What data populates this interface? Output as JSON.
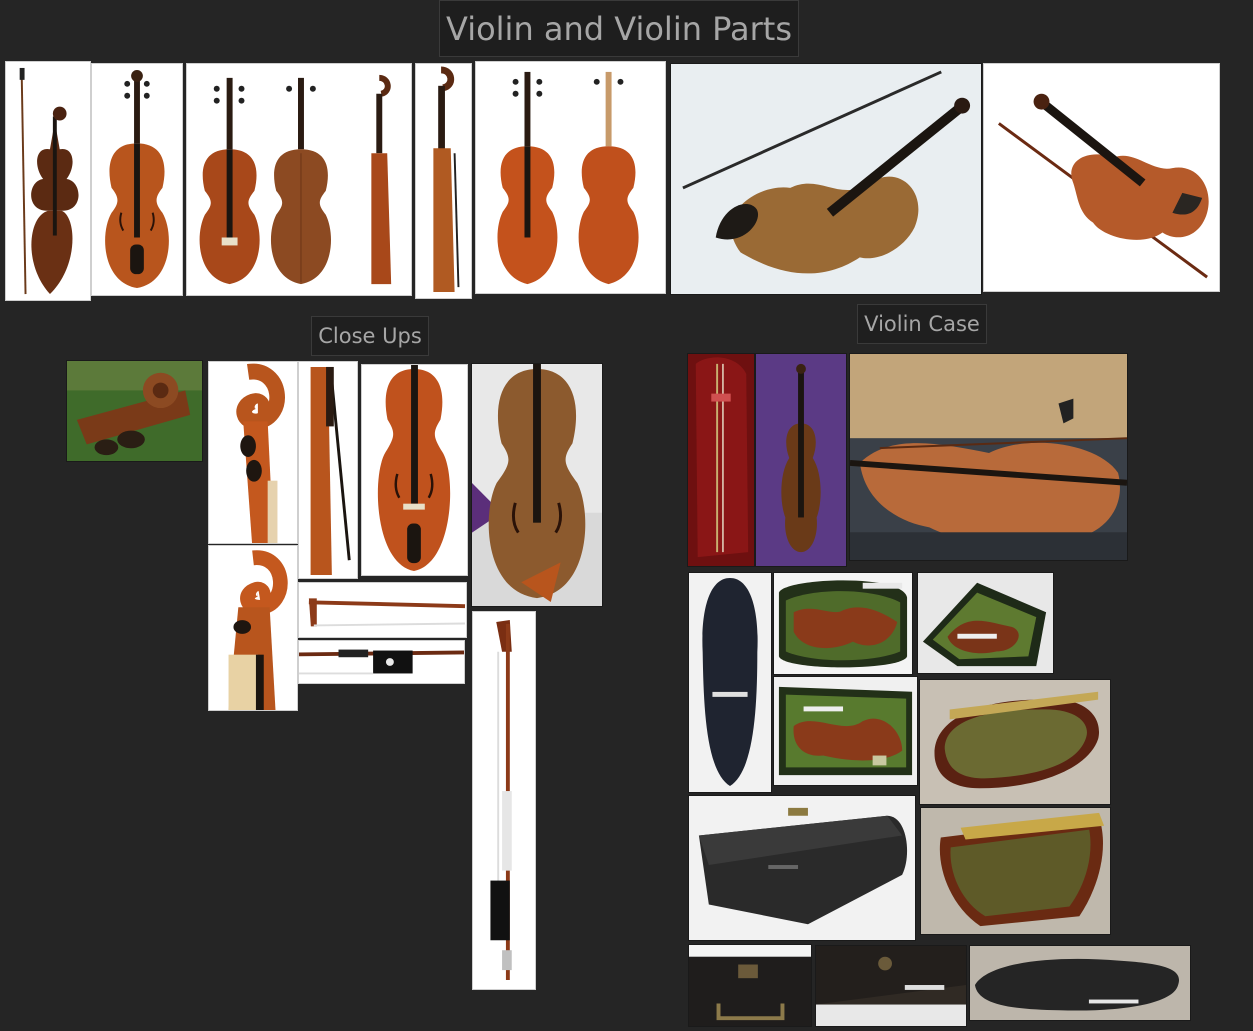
{
  "board": {
    "title": "Violin and Violin Parts",
    "sections": {
      "closeups": "Close Ups",
      "case": "Violin Case"
    }
  },
  "colors": {
    "background": "#252525",
    "wood": "#b8551d",
    "wood_dark": "#6b2a0e",
    "ebony": "#1b1510",
    "case_velvet_red": "#7a1212",
    "case_velvet_purple": "#5b3a85",
    "case_lining_green": "#4f6b2a",
    "case_shell": "#2b2b2b"
  }
}
